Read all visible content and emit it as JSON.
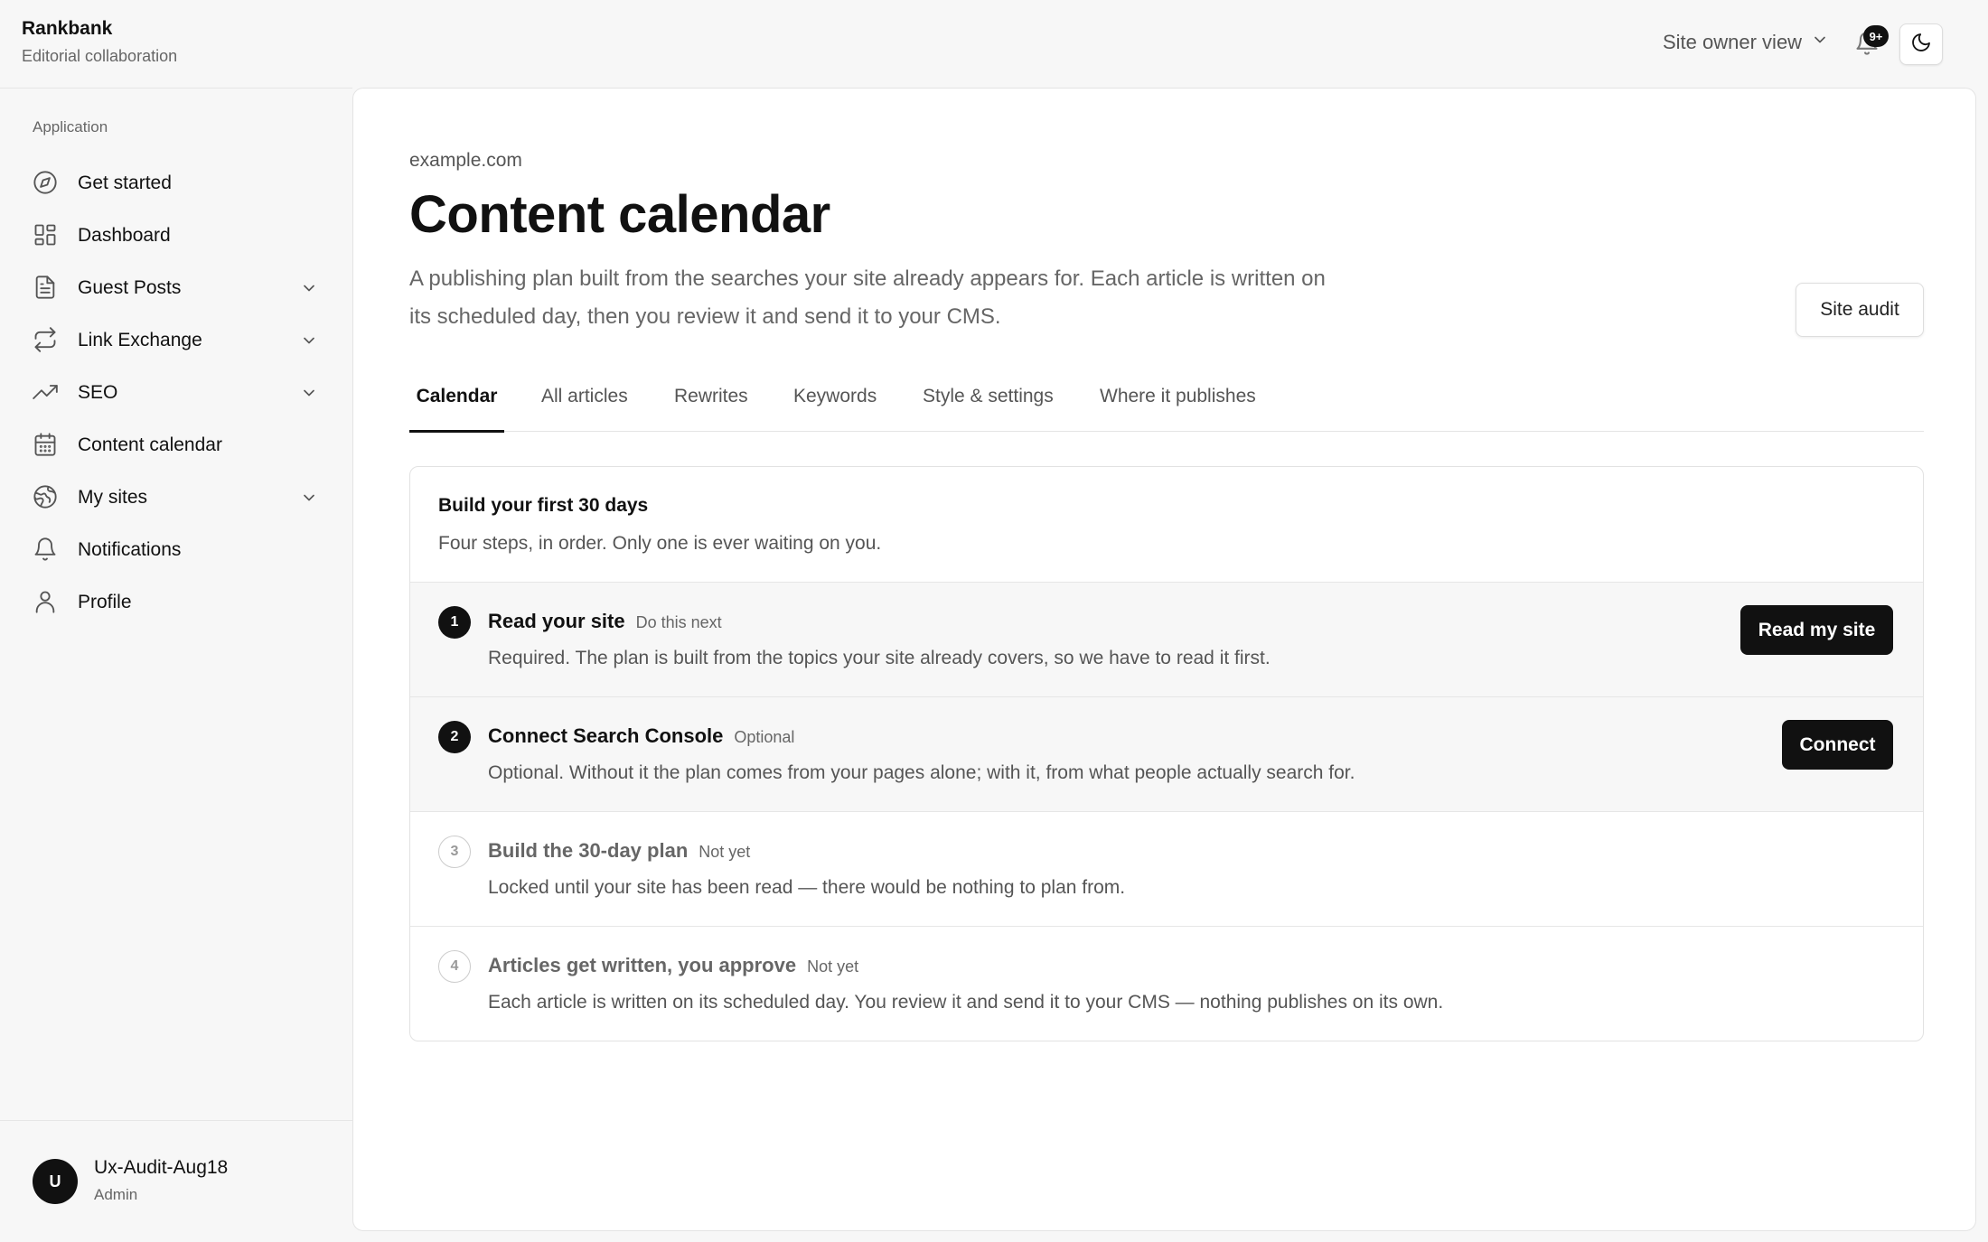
{
  "app": {
    "name": "Rankbank",
    "subtitle": "Editorial collaboration"
  },
  "header": {
    "view_switch_label": "Site owner view",
    "notification_badge": "9+"
  },
  "sidebar": {
    "group_label": "Application",
    "items": [
      {
        "label": "Get started",
        "icon": "compass-icon",
        "has_children": false
      },
      {
        "label": "Dashboard",
        "icon": "grid-icon",
        "has_children": false
      },
      {
        "label": "Guest Posts",
        "icon": "document-icon",
        "has_children": true
      },
      {
        "label": "Link Exchange",
        "icon": "repeat-icon",
        "has_children": true
      },
      {
        "label": "SEO",
        "icon": "trending-up-icon",
        "has_children": true
      },
      {
        "label": "Content calendar",
        "icon": "calendar-icon",
        "has_children": false
      },
      {
        "label": "My sites",
        "icon": "globe-icon",
        "has_children": true
      },
      {
        "label": "Notifications",
        "icon": "bell-icon",
        "has_children": false
      },
      {
        "label": "Profile",
        "icon": "user-icon",
        "has_children": false
      }
    ],
    "user": {
      "initial": "U",
      "name": "Ux-Audit-Aug18",
      "role": "Admin"
    }
  },
  "main": {
    "site": "example.com",
    "title": "Content calendar",
    "description": "A publishing plan built from the searches your site already appears for. Each article is written on its scheduled day, then you review it and send it to your CMS.",
    "audit_button": "Site audit",
    "tabs": [
      {
        "label": "Calendar",
        "active": true
      },
      {
        "label": "All articles",
        "active": false
      },
      {
        "label": "Rewrites",
        "active": false
      },
      {
        "label": "Keywords",
        "active": false
      },
      {
        "label": "Style & settings",
        "active": false
      },
      {
        "label": "Where it publishes",
        "active": false
      }
    ],
    "onboarding": {
      "title": "Build your first 30 days",
      "subtitle": "Four steps, in order. Only one is ever waiting on you.",
      "steps": [
        {
          "number": "1",
          "title": "Read your site",
          "tag": "Do this next",
          "description": "Required. The plan is built from the topics your site already covers, so we have to read it first.",
          "button": "Read my site"
        },
        {
          "number": "2",
          "title": "Connect Search Console",
          "tag": "Optional",
          "description": "Optional. Without it the plan comes from your pages alone; with it, from what people actually search for.",
          "button": "Connect"
        },
        {
          "number": "3",
          "title": "Build the 30-day plan",
          "tag": "Not yet",
          "description": "Locked until your site has been read — there would be nothing to plan from."
        },
        {
          "number": "4",
          "title": "Articles get written, you approve",
          "tag": "Not yet",
          "description": "Each article is written on its scheduled day. You review it and send it to your CMS — nothing publishes on its own."
        }
      ]
    }
  }
}
